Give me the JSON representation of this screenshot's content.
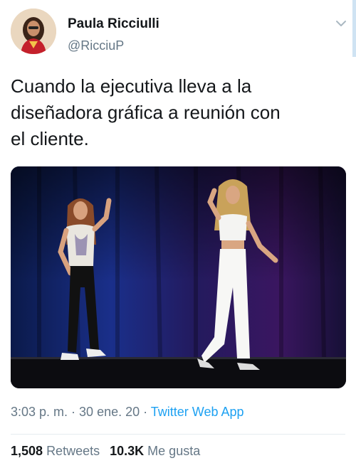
{
  "author": {
    "name": "Paula Ricciulli",
    "handle": "@RicciuP"
  },
  "tweet": {
    "text": "Cuando la ejecutiva lleva a la\ndiseñadora gráfica a reunión con\nel cliente."
  },
  "meta": {
    "time": "3:03 p. m.",
    "separator": " · ",
    "date": "30 ene. 20",
    "app": "Twitter Web App"
  },
  "stats": {
    "retweets_count": "1,508",
    "retweets_label": "Retweets",
    "likes_count": "10.3K",
    "likes_label": "Me gusta"
  },
  "colors": {
    "link": "#1da1f2",
    "secondary_text": "#657786",
    "primary_text": "#14171a"
  },
  "icons": {
    "menu": "chevron-down-icon"
  }
}
